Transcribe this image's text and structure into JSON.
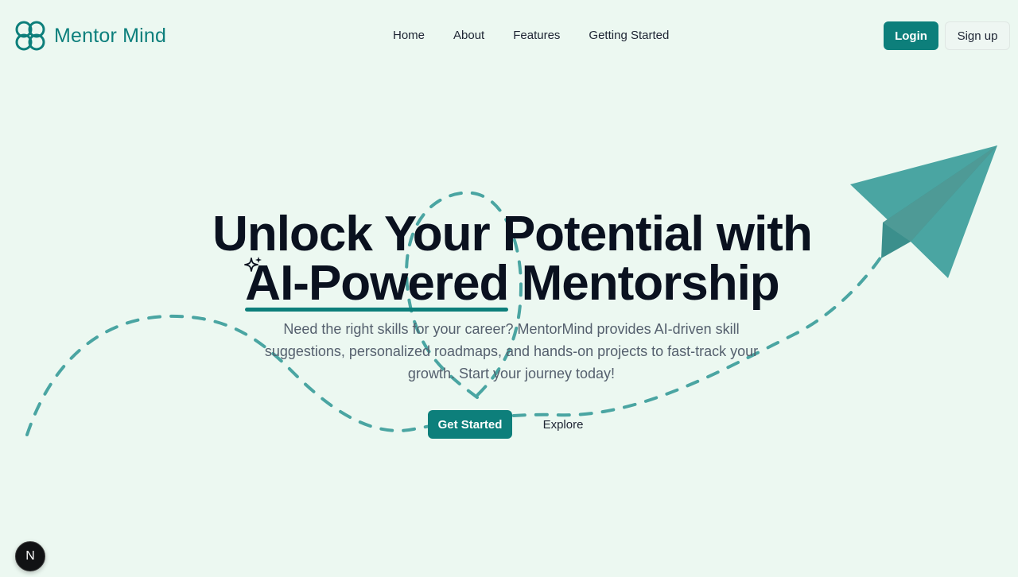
{
  "brand": {
    "name": "Mentor Mind",
    "color": "#0d7f7b",
    "logo_icon": "clover-icon"
  },
  "nav": {
    "items": [
      {
        "label": "Home"
      },
      {
        "label": "About"
      },
      {
        "label": "Features"
      },
      {
        "label": "Getting Started"
      }
    ]
  },
  "auth": {
    "login_label": "Login",
    "signup_label": "Sign up"
  },
  "hero": {
    "title_line1": "Unlock Your Potential with",
    "title_highlight": "AI-Powered",
    "title_rest": " Mentorship",
    "description": "Need the right skills for your career? MentorMind provides AI-driven skill suggestions, personalized roadmaps, and hands-on projects to fast-track your growth. Start your journey today!",
    "primary_cta": "Get Started",
    "secondary_cta": "Explore",
    "decoration_icon": "paper-plane-icon",
    "sparkle_icon": "sparkle-icon"
  },
  "devtools": {
    "badge_label": "N"
  },
  "colors": {
    "background": "#ecf8f1",
    "accent": "#0d7f7b",
    "plane": "#4aa5a2",
    "heading": "#0a111f",
    "body_text": "#55606e"
  }
}
